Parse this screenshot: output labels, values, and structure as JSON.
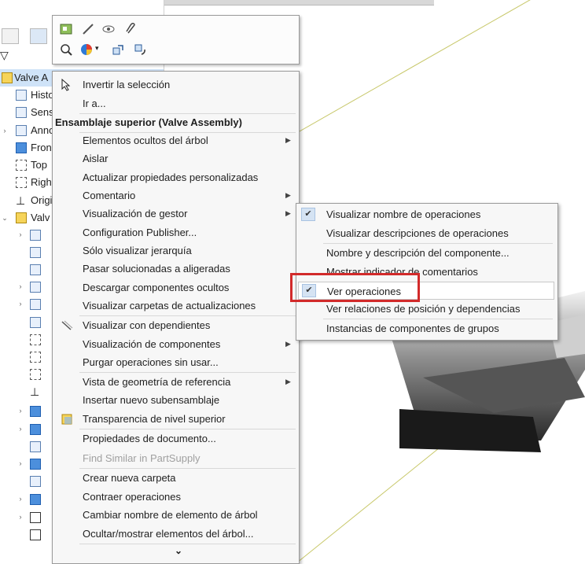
{
  "tree": {
    "root_label": "Valve A",
    "items": [
      {
        "label": "Histo",
        "icon": "history-icon"
      },
      {
        "label": "Sens",
        "icon": "sensors-icon"
      },
      {
        "label": "Anno",
        "icon": "annotations-icon"
      },
      {
        "label": "Fron",
        "icon": "front-plane-icon"
      },
      {
        "label": "Top",
        "icon": "top-plane-icon"
      },
      {
        "label": "Righ",
        "icon": "right-plane-icon"
      },
      {
        "label": "Origi",
        "icon": "origin-icon"
      },
      {
        "label": "Valv",
        "icon": "subassembly-icon"
      }
    ]
  },
  "toolbar": {
    "icons": [
      "feature-icon",
      "hide-icon",
      "show-icon",
      "attach-icon",
      "zoom-icon",
      "appearance-icon",
      "rebuild-icon",
      "rotate-icon"
    ]
  },
  "menu": {
    "invert_selection": "Invertir la selección",
    "goto": "Ir a...",
    "header": "Ensamblaje superior (Valve Assembly)",
    "items": {
      "hidden_tree": "Elementos ocultos del árbol",
      "isolate": "Aislar",
      "update_props": "Actualizar propiedades personalizadas",
      "comment": "Comentario",
      "manager_display": "Visualización de gestor",
      "config_publisher": "Configuration Publisher...",
      "hierarchy_only": "Sólo visualizar jerarquía",
      "set_lightweight": "Pasar solucionadas a aligeradas",
      "unload_hidden": "Descargar componentes ocultos",
      "show_update_folders": "Visualizar carpetas de actualizaciones",
      "show_dependents": "Visualizar con dependientes",
      "component_display": "Visualización de componentes",
      "purge_unused": "Purgar operaciones sin usar...",
      "reference_geometry": "Vista de geometría de referencia",
      "insert_subassembly": "Insertar nuevo subensamblaje",
      "top_transparency": "Transparencia de nivel superior",
      "doc_properties": "Propiedades de documento...",
      "find_similar": "Find Similar in PartSupply",
      "new_folder": "Crear nueva carpeta",
      "collapse": "Contraer operaciones",
      "rename": "Cambiar nombre de elemento de árbol",
      "hide_show": "Ocultar/mostrar elementos del árbol..."
    },
    "more": "⌄"
  },
  "submenu": {
    "items": [
      {
        "label": "Visualizar nombre de operaciones",
        "checked": true
      },
      {
        "label": "Visualizar descripciones de operaciones",
        "checked": false
      },
      {
        "label": "Nombre y descripción del componente...",
        "checked": false
      },
      {
        "label": "Mostrar indicador de comentarios",
        "checked": false
      },
      {
        "label": "Ver operaciones",
        "checked": true
      },
      {
        "label": "Ver relaciones de posición y dependencias",
        "checked": false
      },
      {
        "label": "Instancias de componentes de grupos",
        "checked": false
      }
    ]
  },
  "colors": {
    "highlight_box": "#d22a2a",
    "check_bg": "#d5e3f3",
    "menu_bg": "#f7f7f7"
  }
}
